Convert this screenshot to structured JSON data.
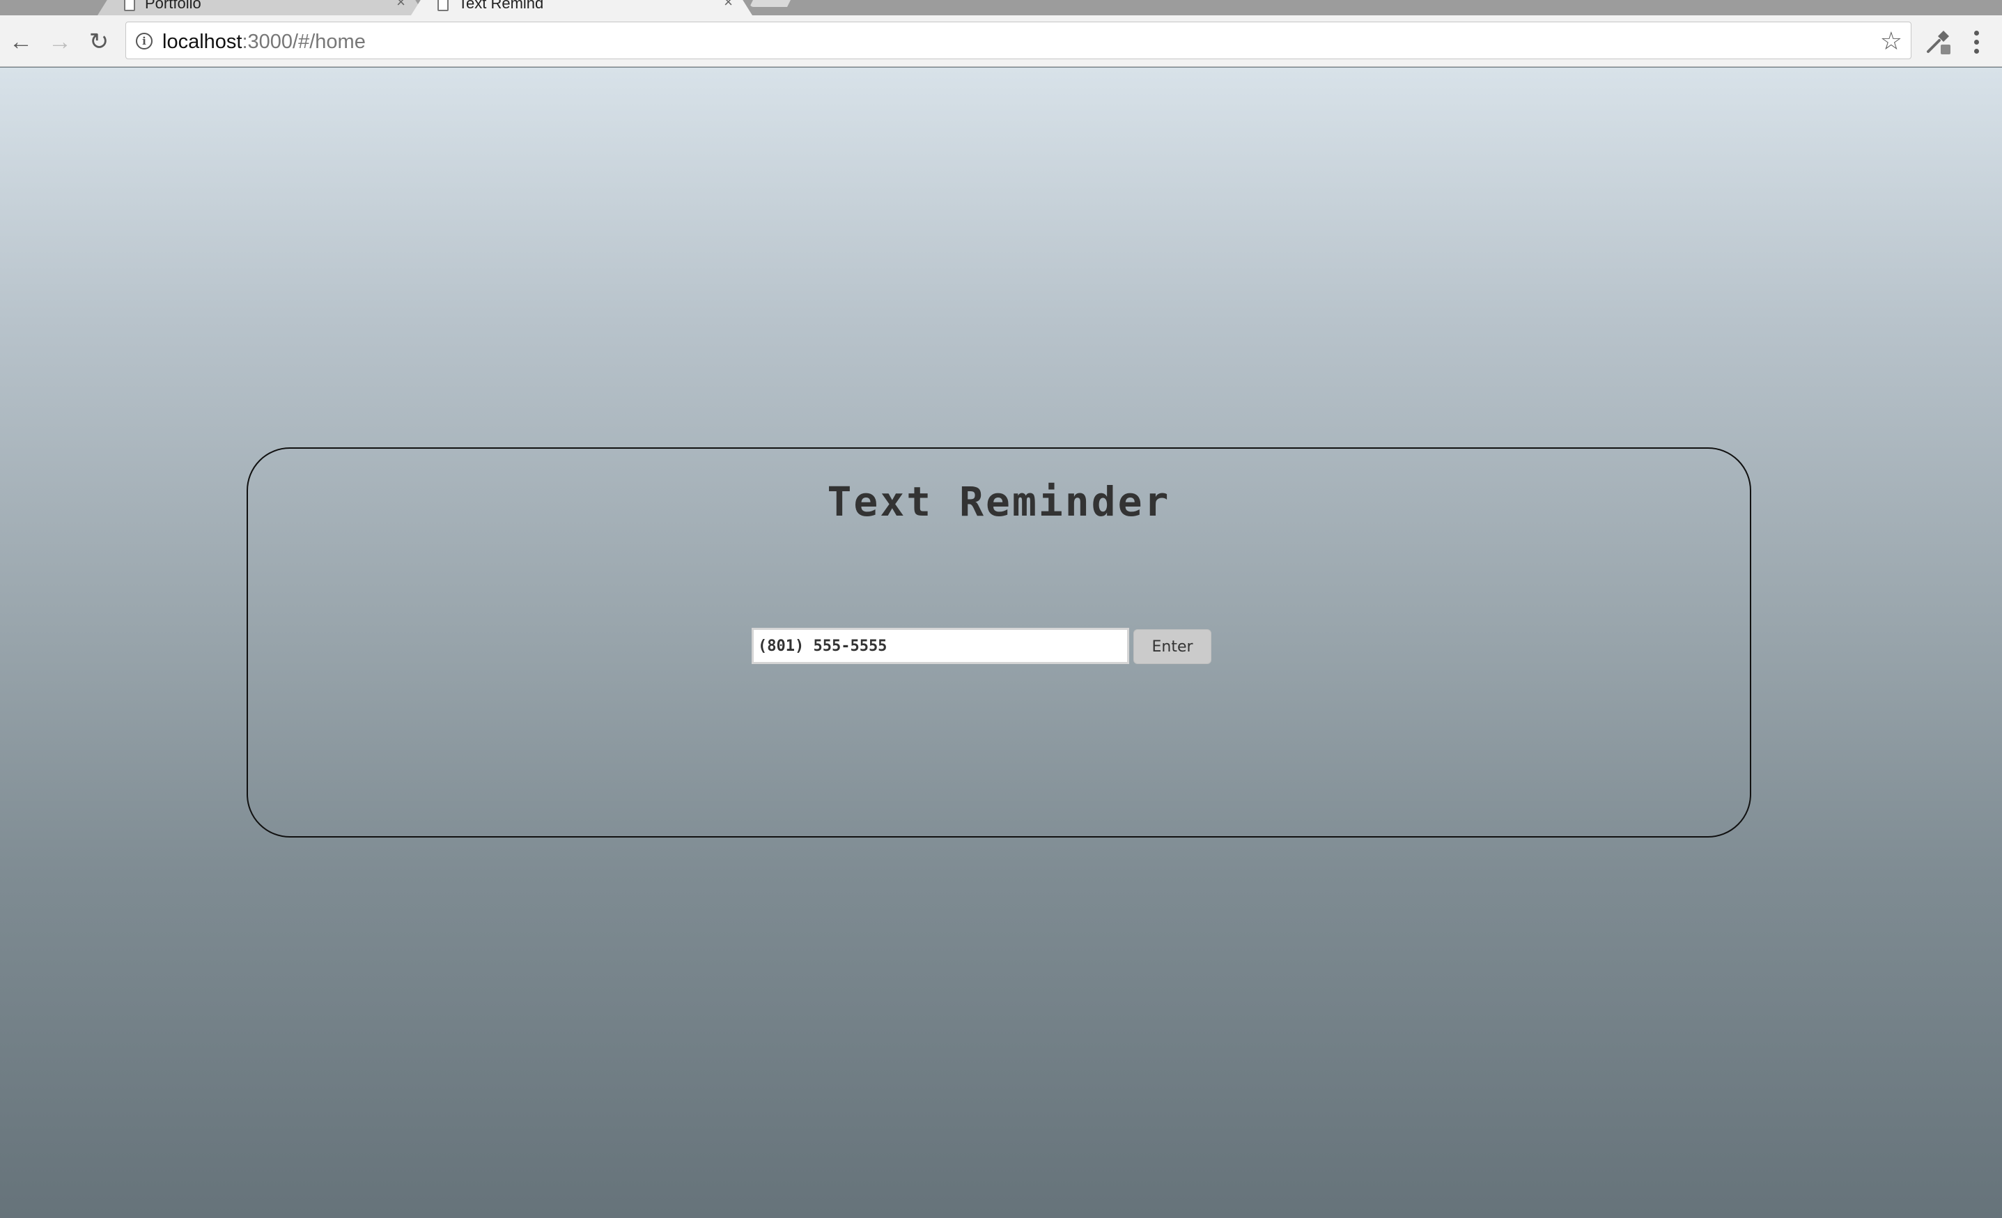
{
  "browser": {
    "tabs": [
      {
        "title": "Portfolio",
        "active": false
      },
      {
        "title": "Text Remind",
        "active": true
      }
    ],
    "url_host": "localhost",
    "url_rest": ":3000/#/home",
    "icons": {
      "back": "arrow-left-icon",
      "forward": "arrow-right-icon",
      "reload": "reload-icon",
      "info": "info-icon",
      "bookmark": "star-icon",
      "extension": "eyedropper-icon",
      "menu": "kebab-menu-icon"
    }
  },
  "page": {
    "title": "Text Reminder",
    "phone_input": {
      "value": "(801) 555-5555"
    },
    "enter_label": "Enter",
    "colors": {
      "gradient_top": "#d8e2e9",
      "gradient_bottom": "#66737a",
      "card_border": "#111111",
      "title_text": "#333333",
      "button_bg": "#cbcbcb"
    }
  }
}
